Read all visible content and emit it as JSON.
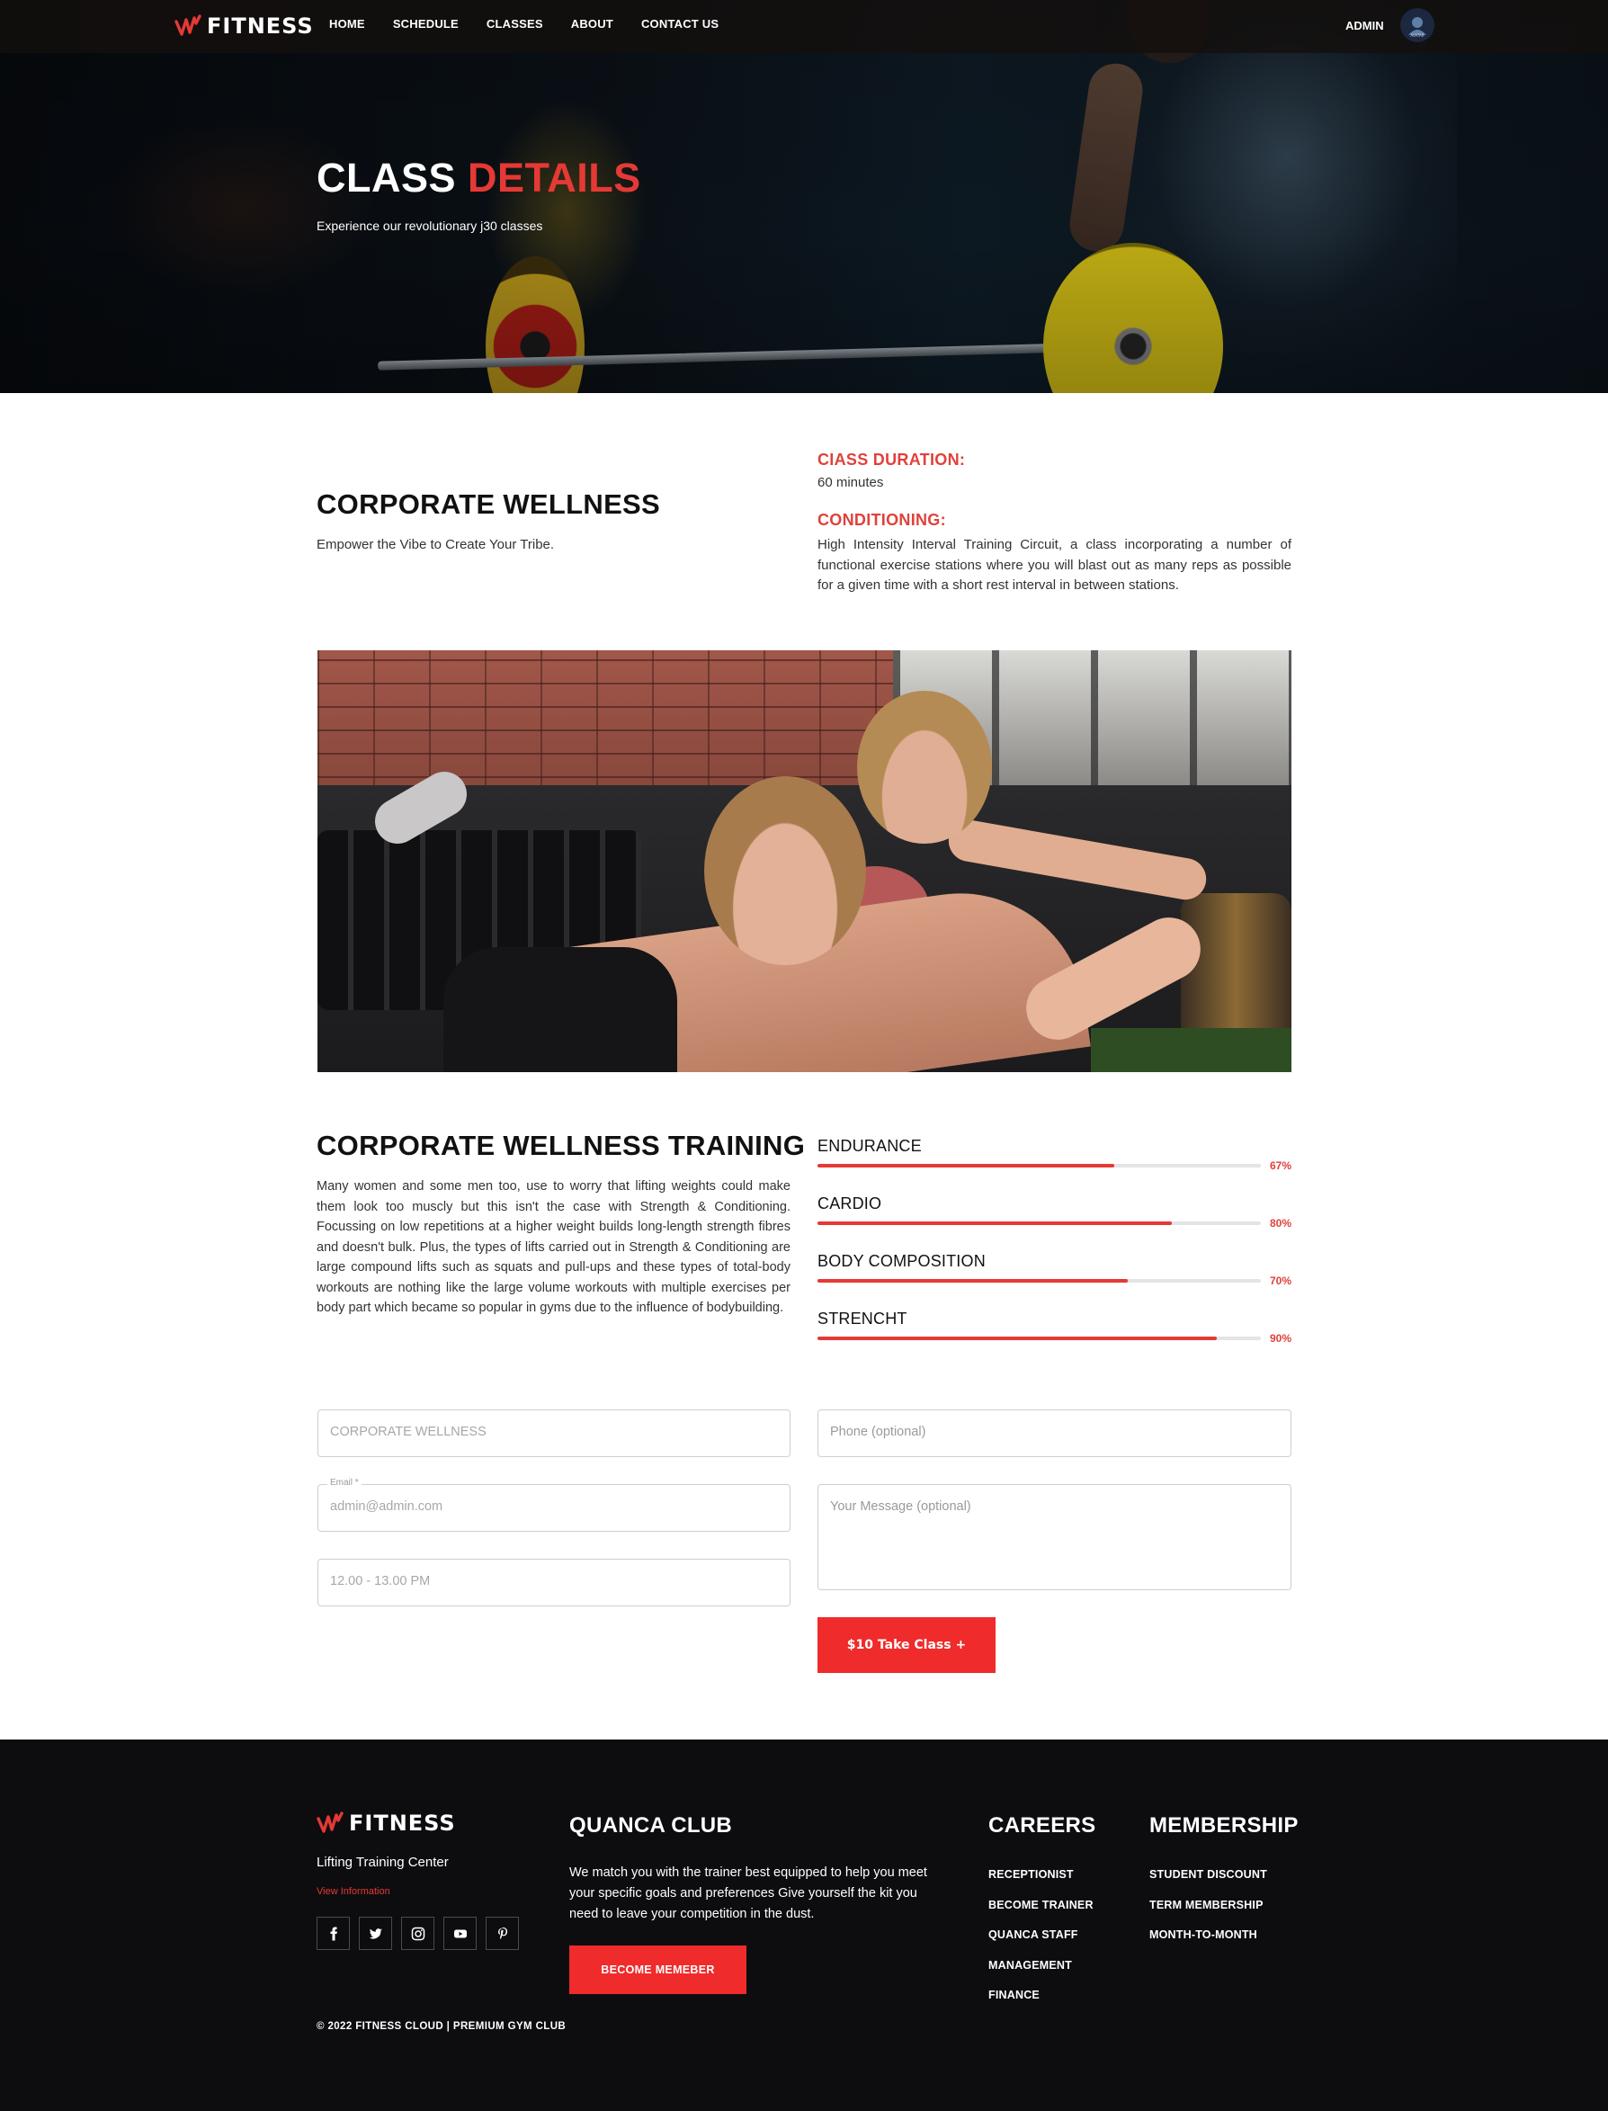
{
  "header": {
    "logo_text": "FITNESS",
    "nav": [
      "HOME",
      "SCHEDULE",
      "CLASSES",
      "ABOUT",
      "CONTACT US"
    ],
    "admin_label": "ADMIN",
    "avatar_text": "AVATAR"
  },
  "hero": {
    "title_white": "CLASS",
    "title_red": "DETAILS",
    "subtitle": "Experience our revolutionary j30 classes"
  },
  "intro": {
    "title": "CORPORATE WELLNESS",
    "tagline": "Empower the Vibe to Create Your Tribe.",
    "duration_label": "CIASS DURATION:",
    "duration_value": "60 minutes",
    "conditioning_label": "CONDITIONING:",
    "conditioning_text": "High Intensity Interval Training Circuit, a class incorporating a number of functional exercise stations where you will blast out as many reps as possible for a given time with a short rest interval in between stations."
  },
  "training": {
    "title": "CORPORATE WELLNESS TRAINING",
    "text": "Many women and some men too, use to worry that lifting weights could make them look too muscly but this isn't the case with Strength & Conditioning. Focussing on low repetitions at a higher weight builds long-length strength fibres and doesn't bulk. Plus, the types of lifts carried out in Strength & Conditioning are large compound lifts such as squats and pull-ups and these types of total-body workouts are nothing like the large volume workouts with multiple exercises per body part which became so popular in gyms due to the influence of bodybuilding.",
    "skills": [
      {
        "name": "ENDURANCE",
        "value": 67,
        "label": "67%"
      },
      {
        "name": "CARDIO",
        "value": 80,
        "label": "80%"
      },
      {
        "name": "BODY COMPOSITION",
        "value": 70,
        "label": "70%"
      },
      {
        "name": "STRENCHT",
        "value": 90,
        "label": "90%"
      }
    ]
  },
  "form": {
    "class_value": "CORPORATE WELLNESS",
    "email_legend": "Email *",
    "email_value": "admin@admin.com",
    "time_value": "12.00 - 13.00 PM",
    "phone_placeholder": "Phone (optional)",
    "message_placeholder": "Your Message (optional)",
    "submit_label": "$10 Take Class +"
  },
  "footer": {
    "logo_text": "FITNESS",
    "center_name": "Lifting Training Center",
    "view_info": "View Information",
    "social_icons": [
      "facebook-icon",
      "twitter-icon",
      "instagram-icon",
      "youtube-icon",
      "pinterest-icon"
    ],
    "club_title": "QUANCA CLUB",
    "club_text_line1": "We match you with the trainer best equipped to help you meet",
    "club_text_line2": "your specific goals and preferences Give yourself the kit you",
    "club_text_line3": "need to leave your competition in the dust.",
    "become_label": "BECOME MEMEBER",
    "careers_title": "CAREERS",
    "careers": [
      "RECEPTIONIST",
      "BECOME TRAINER",
      "QUANCA STAFF",
      "MANAGEMENT",
      "FINANCE"
    ],
    "membership_title": "MEMBERSHIP",
    "membership": [
      "STUDENT DISCOUNT",
      "TERM MEMBERSHIP",
      "MONTH-TO-MONTH"
    ],
    "copyright": "© 2022 FITNESS CLOUD | PREMIUM GYM CLUB"
  },
  "colors": {
    "accent": "#e53935",
    "footer_bg": "#0d0d0f",
    "button": "#ef2b2b"
  }
}
